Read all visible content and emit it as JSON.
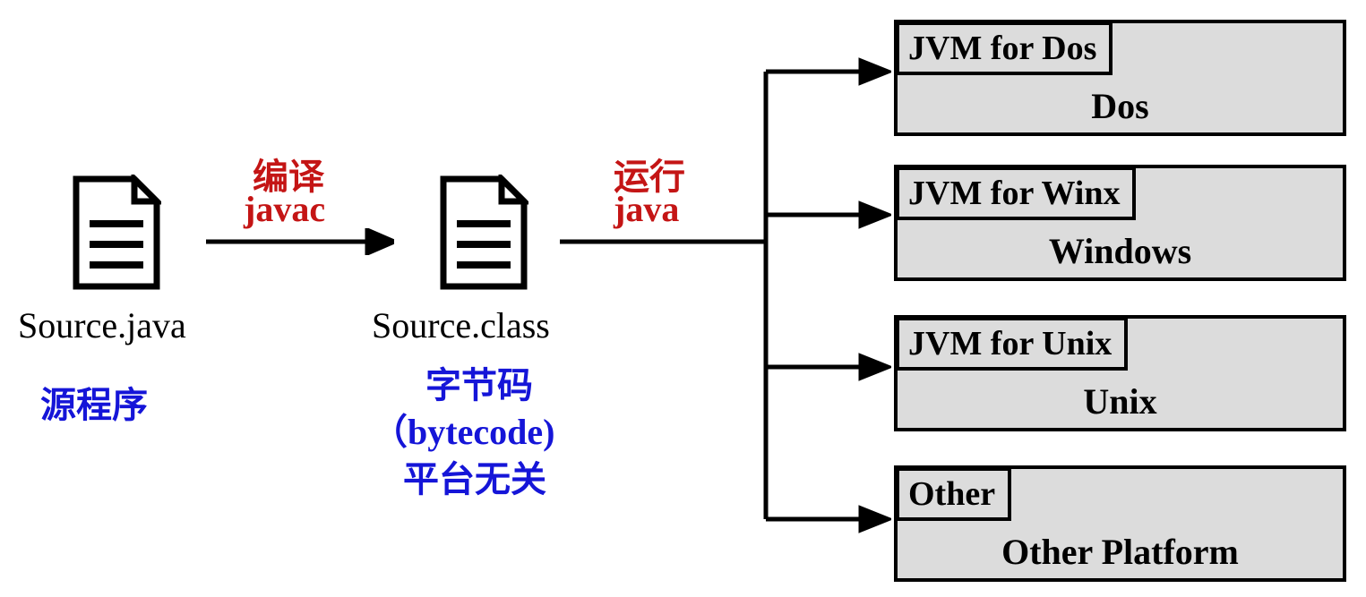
{
  "source": {
    "filename": "Source.java",
    "caption": "源程序"
  },
  "compile": {
    "step_label": "编译",
    "command": "javac"
  },
  "bytecode": {
    "filename": "Source.class",
    "caption_line1": "字节码",
    "caption_line2": "（bytecode)",
    "caption_line3": "平台无关"
  },
  "run": {
    "step_label": "运行",
    "command": "java"
  },
  "platforms": [
    {
      "jvm": "JVM for Dos",
      "os": "Dos"
    },
    {
      "jvm": "JVM for Winx",
      "os": "Windows"
    },
    {
      "jvm": "JVM for Unix",
      "os": "Unix"
    },
    {
      "jvm": "Other",
      "os": "Other Platform"
    }
  ]
}
